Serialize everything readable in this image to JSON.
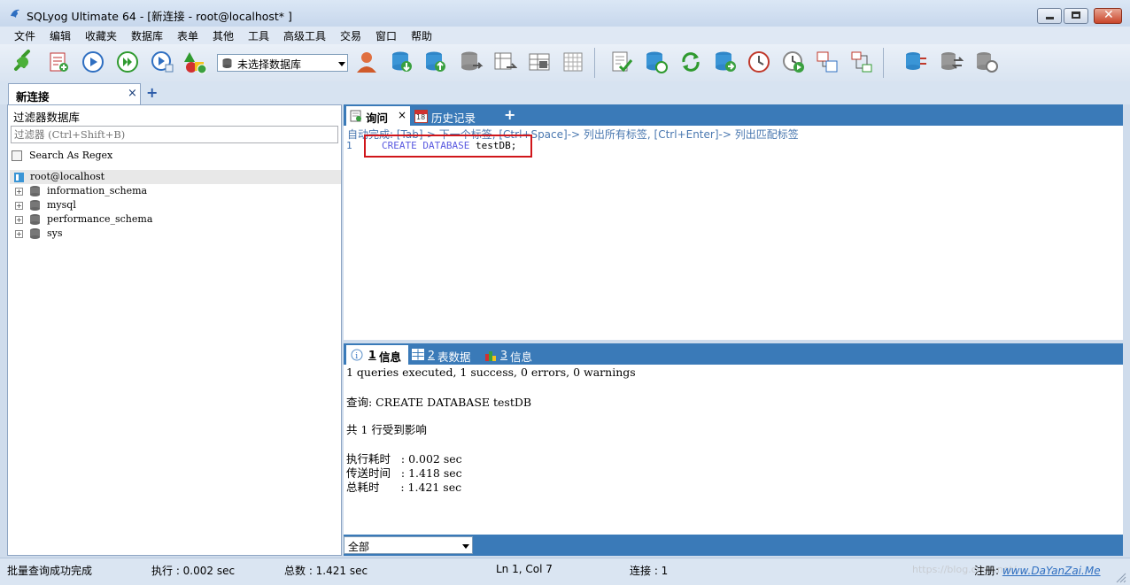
{
  "window": {
    "title": "SQLyog Ultimate 64 - [新连接 - root@localhost* ]"
  },
  "menu": [
    "文件",
    "编辑",
    "收藏夹",
    "数据库",
    "表单",
    "其他",
    "工具",
    "高级工具",
    "交易",
    "窗口",
    "帮助"
  ],
  "toolbar": {
    "db_select_value": "未选择数据库",
    "icons": [
      "new-connection-icon",
      "new-query-icon",
      "execute-query-icon",
      "execute-all-icon",
      "execute-explain-icon",
      "schema-designer-icon",
      "user-manager-icon",
      "backup-icon",
      "restore-icon",
      "import-icon",
      "export-icon",
      "table-data-icon",
      "grid-icon",
      "sql-formatter-icon",
      "sync-icon",
      "refresh-icon",
      "copy-db-icon",
      "scheduler-icon",
      "job-agent-icon",
      "query-builder-icon",
      "schema-sync-icon",
      "db-sync-icon",
      "data-sync-icon",
      "migration-icon"
    ]
  },
  "connection_tab": {
    "label": "新连接",
    "close": "×",
    "add": "+"
  },
  "left_panel": {
    "filter_title": "过滤器数据库",
    "filter_placeholder": "过滤器 (Ctrl+Shift+B)",
    "regex_label": "Search As Regex",
    "root": "root@localhost",
    "databases": [
      "information_schema",
      "mysql",
      "performance_schema",
      "sys"
    ]
  },
  "editor": {
    "tabs": [
      {
        "label": "询问",
        "close": "×"
      },
      {
        "label": "历史记录",
        "icon_text": "18"
      }
    ],
    "add_tab": "+",
    "autocomplete_hint": "自动完成: [Tab]-> 下一个标签, [Ctrl+Space]-> 列出所有标签, [Ctrl+Enter]-> 列出匹配标签",
    "line_number": "1",
    "code_keyword_1": "CREATE",
    "code_keyword_2": "DATABASE",
    "code_rest": "testDB;"
  },
  "results": {
    "tabs": [
      {
        "num": "1",
        "label": "信息"
      },
      {
        "num": "2",
        "label": "表数据"
      },
      {
        "num": "3",
        "label": "信息"
      }
    ],
    "lines": [
      "1 queries executed, 1 success, 0 errors, 0 warnings",
      "查询: CREATE DATABASE testDB",
      "共 1 行受到影响",
      "执行耗时   : 0.002 sec",
      "传送时间   : 1.418 sec",
      "总耗时      : 1.421 sec"
    ],
    "filter_value": "全部"
  },
  "status": {
    "message": "批量查询成功完成",
    "exec": "执行 : 0.002 sec",
    "total": "总数 : 1.421 sec",
    "position": "Ln 1, Col 7",
    "connections": "连接 : 1",
    "register": "注册: ",
    "register_link": "www.DaYanZai.Me",
    "watermark": "https://blog.csdn.net/..."
  },
  "colors": {
    "accent_blue": "#3a7ab8",
    "highlight_red": "#d0161b",
    "keyword": "#5a5ae0"
  }
}
